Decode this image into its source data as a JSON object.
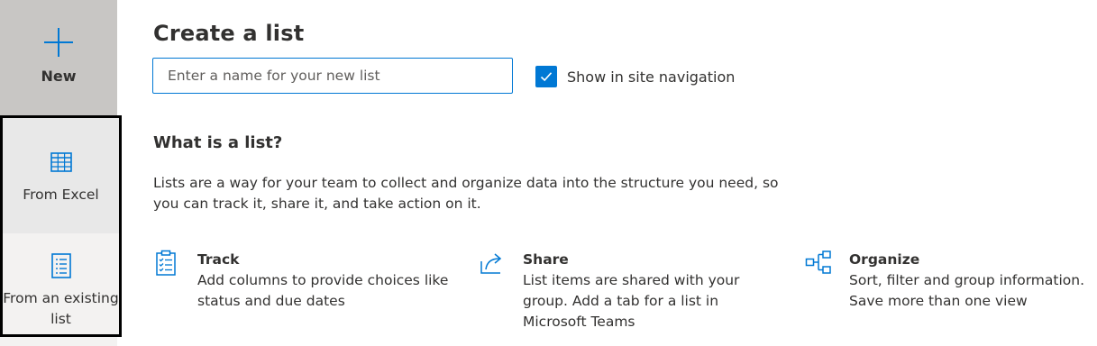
{
  "rail": {
    "new_label": "New",
    "from_excel_label": "From Excel",
    "from_existing_label": "From an existing list"
  },
  "create": {
    "title": "Create a list",
    "name_placeholder": "Enter a name for your new list",
    "name_value": "",
    "show_in_nav_label": "Show in site navigation",
    "show_in_nav_checked": true
  },
  "about": {
    "heading": "What is a list?",
    "description": "Lists are a way for your team to collect and organize data into the structure you need, so you can track it, share it, and take action on it."
  },
  "features": [
    {
      "icon": "clipboard-checklist-icon",
      "title": "Track",
      "description": "Add columns to provide choices like status and due dates"
    },
    {
      "icon": "share-arrow-icon",
      "title": "Share",
      "description": "List items are shared with your group. Add a tab for a list in Microsoft Teams"
    },
    {
      "icon": "hierarchy-icon",
      "title": "Organize",
      "description": "Sort, filter and group information. Save more than one view"
    }
  ],
  "colors": {
    "accent": "#0078d4",
    "rail_new_bg": "#c8c6c4",
    "rail_bg": "#f3f2f1",
    "text": "#323130"
  }
}
